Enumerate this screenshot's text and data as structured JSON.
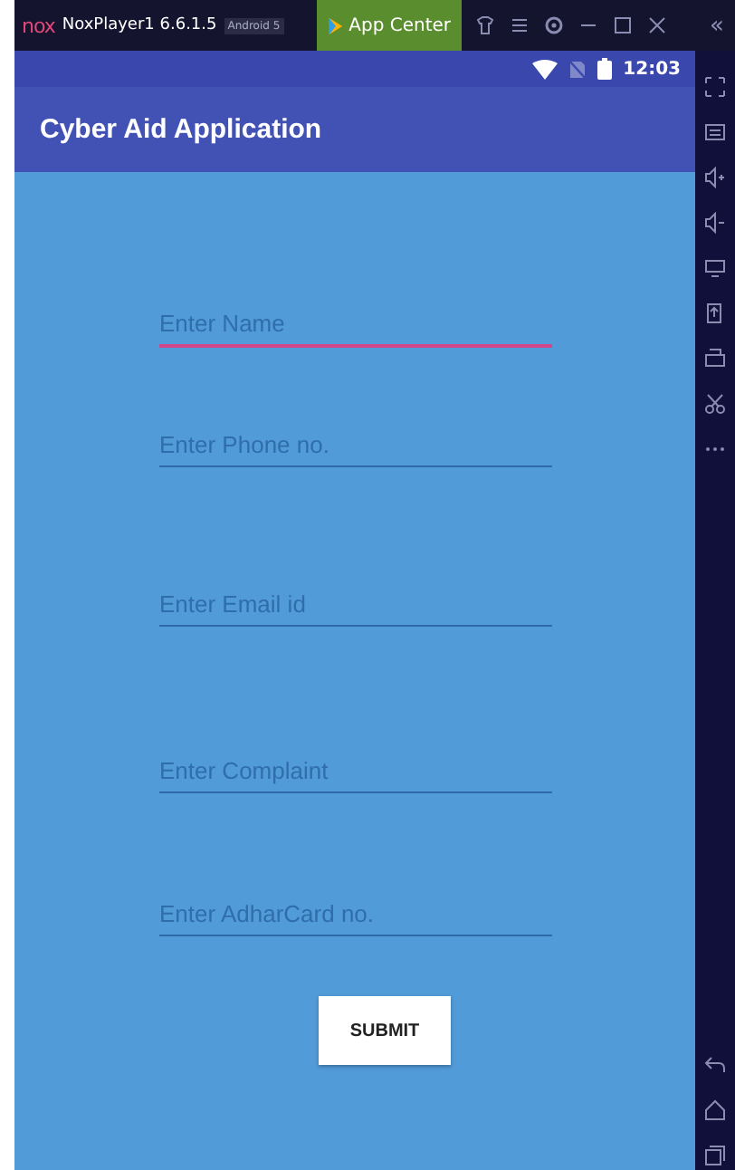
{
  "emulator_bar": {
    "brand": "nox",
    "title": "NoxPlayer1 6.6.1.5",
    "badge": "Android 5",
    "app_center": "App Center",
    "collapse": "«"
  },
  "status_bar": {
    "time": "12:03"
  },
  "app_bar": {
    "title": "Cyber Aid Application"
  },
  "fields": [
    {
      "placeholder": "Enter Name",
      "focused": true
    },
    {
      "placeholder": "Enter Phone no.",
      "focused": false
    },
    {
      "placeholder": "Enter Email id",
      "focused": false
    },
    {
      "placeholder": "Enter Complaint",
      "focused": false
    },
    {
      "placeholder": "Enter AdharCard no.",
      "focused": false
    }
  ],
  "submit_button": "SUBMIT"
}
